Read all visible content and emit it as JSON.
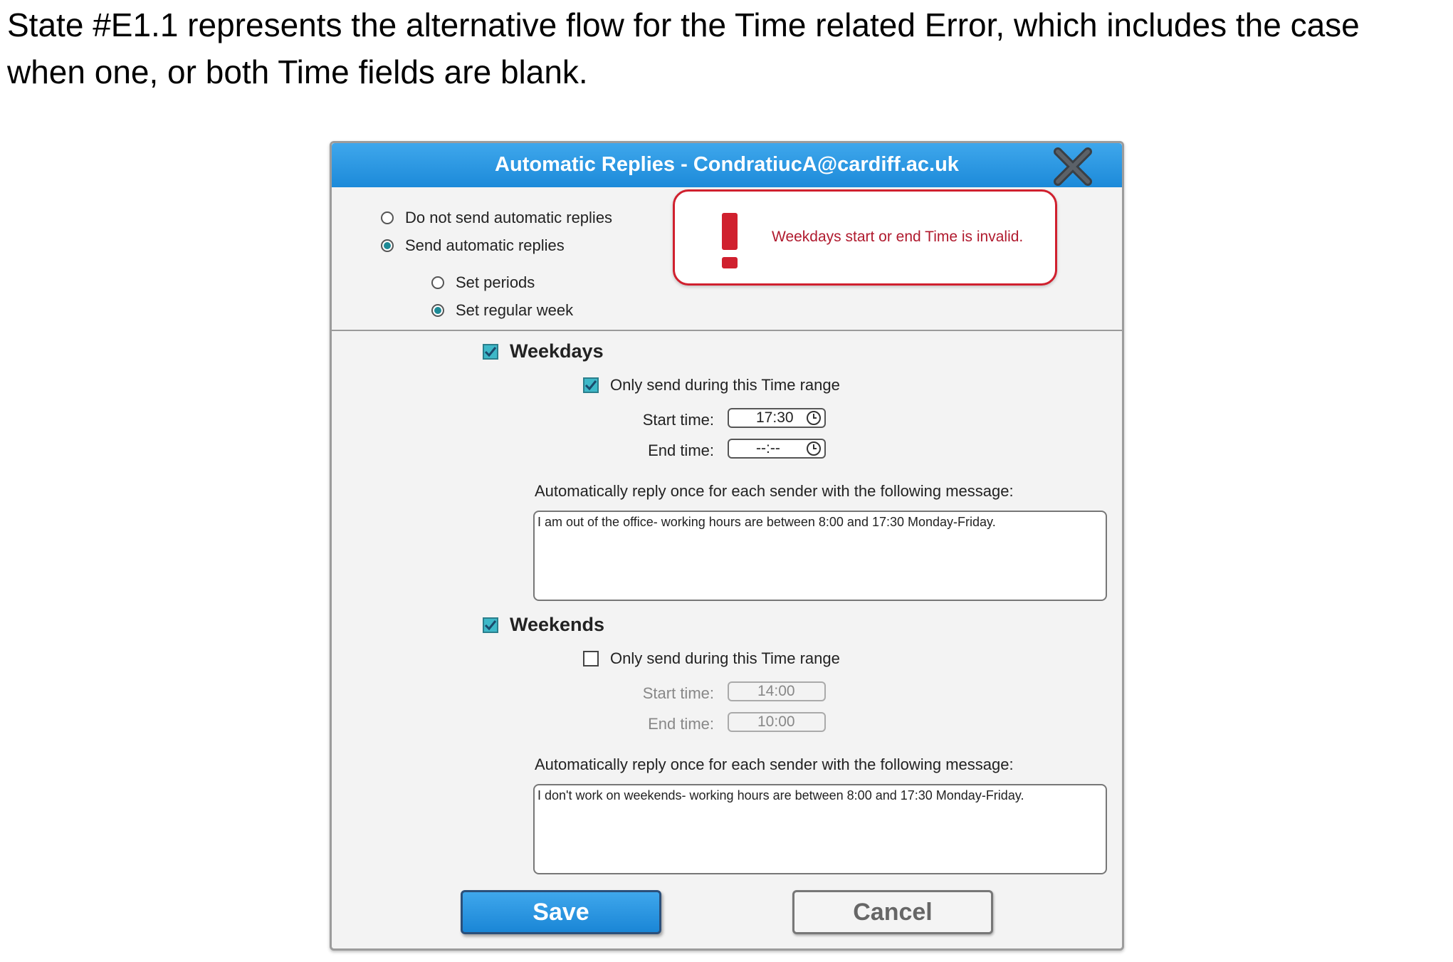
{
  "caption": "State #E1.1 represents the alternative flow for the Time related Error, which includes the case when one, or both Time fields are blank.",
  "dialog": {
    "title": "Automatic Replies - CondratiucA@cardiff.ac.uk",
    "close_icon": "close-x-icon"
  },
  "reply_mode": {
    "options": [
      {
        "label": "Do not send automatic replies",
        "selected": false
      },
      {
        "label": "Send automatic replies",
        "selected": true
      }
    ]
  },
  "schedule_mode": {
    "options": [
      {
        "label": "Set periods",
        "selected": false
      },
      {
        "label": "Set regular week",
        "selected": true
      }
    ]
  },
  "error": {
    "icon": "exclamation-icon",
    "message": "Weekdays start or end Time is invalid.",
    "color": "#d0202e"
  },
  "weekdays": {
    "label": "Weekdays",
    "checked": true,
    "time_range_label": "Only send during this Time range",
    "time_range_checked": true,
    "start_label": "Start time:",
    "start_value": "17:30",
    "end_label": "End time:",
    "end_value": "--:--",
    "message_label": "Automatically reply once for each sender with the following message:",
    "message": "I am out of the office- working hours are between 8:00 and 17:30 Monday-Friday."
  },
  "weekends": {
    "label": "Weekends",
    "checked": true,
    "time_range_label": "Only send during this Time range",
    "time_range_checked": false,
    "start_label": "Start time:",
    "start_value": "14:00",
    "end_label": "End time:",
    "end_value": "10:00",
    "message_label": "Automatically reply once for each sender with the following message:",
    "message": "I don't work on weekends- working hours are between 8:00 and 17:30 Monday-Friday."
  },
  "buttons": {
    "save": "Save",
    "cancel": "Cancel"
  },
  "colors": {
    "titlebar": "#1c8ad9",
    "accent": "#3eb8c8",
    "error_text": "#b01a2e"
  }
}
